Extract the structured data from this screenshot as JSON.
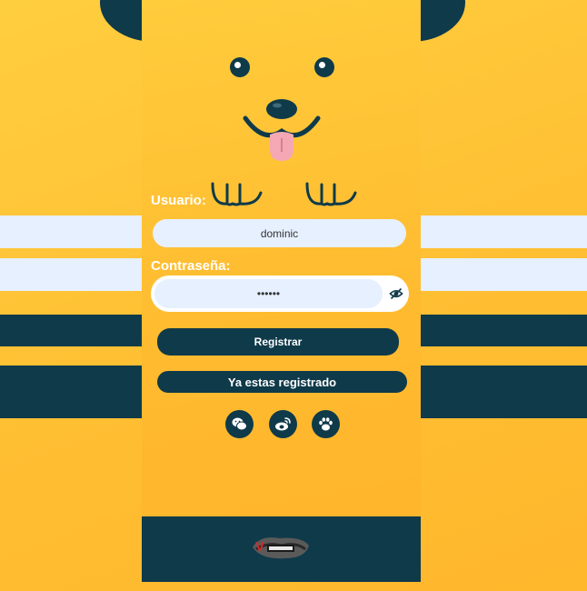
{
  "form": {
    "username_label": "Usuario:",
    "username_value": "dominic",
    "password_label": "Contraseña:",
    "password_value": "••••••"
  },
  "buttons": {
    "register": "Registrar",
    "already_registered": "Ya estas registrado"
  },
  "social": [
    "wechat-icon",
    "weibo-icon",
    "paw-icon"
  ],
  "colors": {
    "background": "#ffc034",
    "dark": "#0f3a4a",
    "light": "#e6f0ff",
    "tongue": "#f4a8b4"
  }
}
